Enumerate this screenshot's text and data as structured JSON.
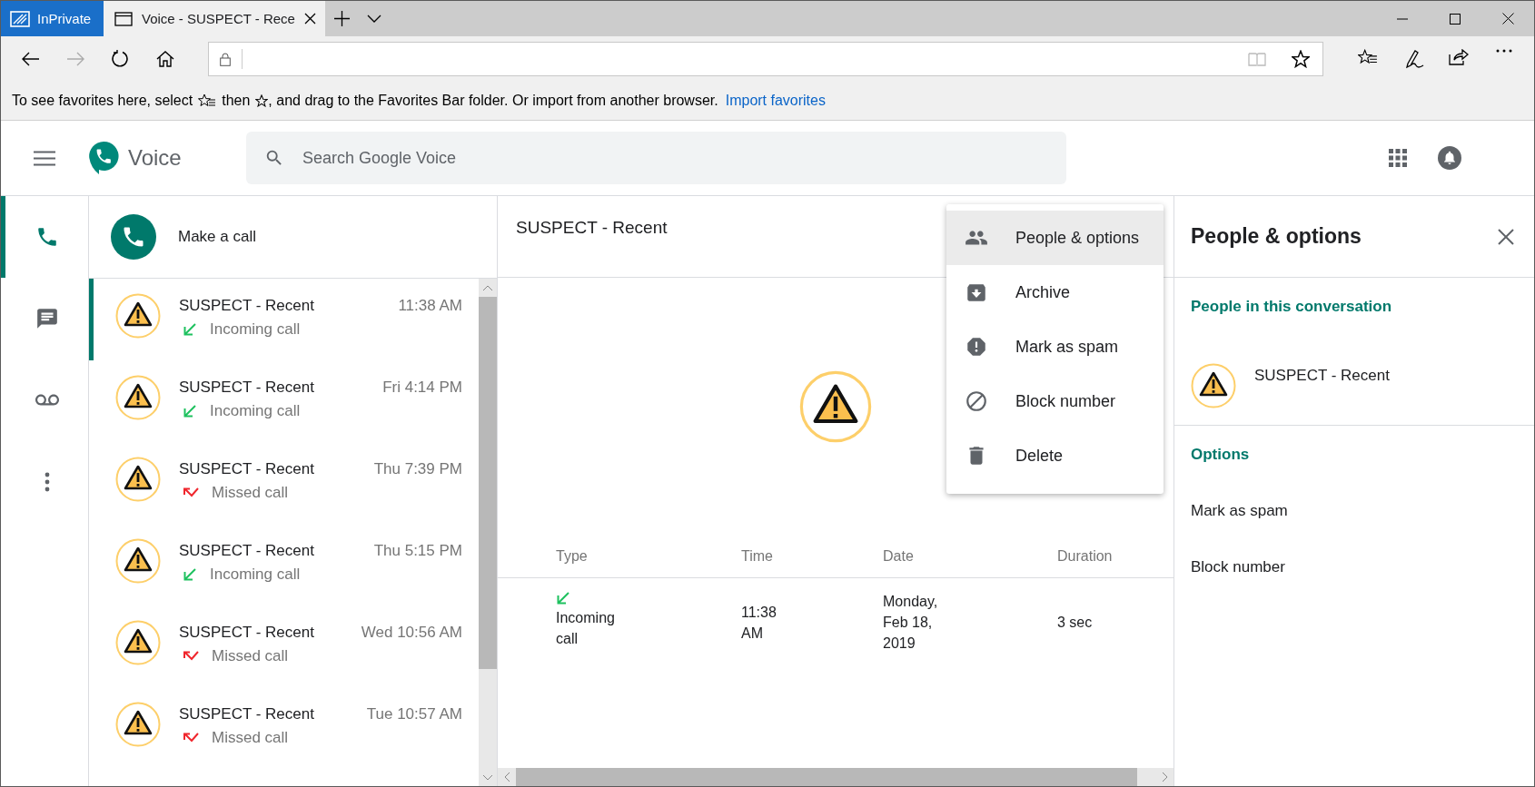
{
  "browser": {
    "private_label": "InPrivate",
    "tab_title": "Voice - SUSPECT - Rece",
    "favorites_bar": {
      "text_before": "To see favorites here, select",
      "text_middle": "then",
      "text_after": ", and drag to the Favorites Bar folder. Or import from another browser.",
      "link": "Import favorites"
    }
  },
  "app": {
    "name": "Voice",
    "search": {
      "placeholder": "Search Google Voice"
    }
  },
  "rail": [
    {
      "kind": "calls",
      "selected": true
    },
    {
      "kind": "messages",
      "selected": false
    },
    {
      "kind": "voicemail",
      "selected": false
    },
    {
      "kind": "more",
      "selected": false
    }
  ],
  "make_call": {
    "label": "Make a call"
  },
  "calls": [
    {
      "name": "SUSPECT - Recent",
      "kind": "incoming",
      "detail": "Incoming call",
      "time": "11:38 AM",
      "selected": true
    },
    {
      "name": "SUSPECT - Recent",
      "kind": "incoming",
      "detail": "Incoming call",
      "time": "Fri 4:14 PM",
      "selected": false
    },
    {
      "name": "SUSPECT - Recent",
      "kind": "missed",
      "detail": "Missed call",
      "time": "Thu 7:39 PM",
      "selected": false
    },
    {
      "name": "SUSPECT - Recent",
      "kind": "incoming",
      "detail": "Incoming call",
      "time": "Thu 5:15 PM",
      "selected": false
    },
    {
      "name": "SUSPECT - Recent",
      "kind": "missed",
      "detail": "Missed call",
      "time": "Wed 10:56 AM",
      "selected": false
    },
    {
      "name": "SUSPECT - Recent",
      "kind": "missed",
      "detail": "Missed call",
      "time": "Tue 10:57 AM",
      "selected": false
    }
  ],
  "conversation": {
    "title": "SUSPECT - Recent",
    "table": {
      "columns": [
        "Type",
        "Time",
        "Date",
        "Duration"
      ],
      "rows": [
        {
          "kind": "incoming",
          "type": "Incoming call",
          "time": "11:38 AM",
          "date": "Monday, Feb 18, 2019",
          "duration": "3 sec"
        }
      ]
    }
  },
  "menu": [
    {
      "kind": "people",
      "label": "People & options",
      "highlighted": true
    },
    {
      "kind": "archive",
      "label": "Archive",
      "highlighted": false
    },
    {
      "kind": "spam",
      "label": "Mark as spam",
      "highlighted": false
    },
    {
      "kind": "block",
      "label": "Block number",
      "highlighted": false
    },
    {
      "kind": "delete",
      "label": "Delete",
      "highlighted": false
    }
  ],
  "side_panel": {
    "title": "People & options",
    "people_heading": "People in this conversation",
    "people": [
      "SUSPECT - Recent"
    ],
    "options_heading": "Options",
    "options": [
      "Mark as spam",
      "Block number"
    ]
  }
}
